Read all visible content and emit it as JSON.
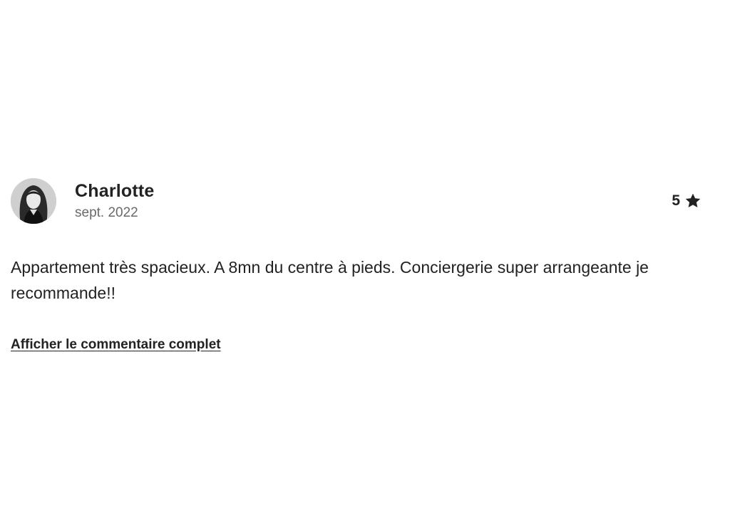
{
  "review": {
    "author": {
      "name": "Charlotte",
      "date": "sept. 2022",
      "avatar": "user-photo-avatar"
    },
    "rating": {
      "value": "5",
      "icon": "star-icon",
      "score": 5
    },
    "text": "Appartement très spacieux. A 8mn du centre à pieds. Conciergerie super arrangeante je recommande!!",
    "show_more_label": "Afficher le commentaire complet"
  },
  "colors": {
    "text_primary": "#222222",
    "text_secondary": "#6a6a6a",
    "background": "#ffffff"
  }
}
